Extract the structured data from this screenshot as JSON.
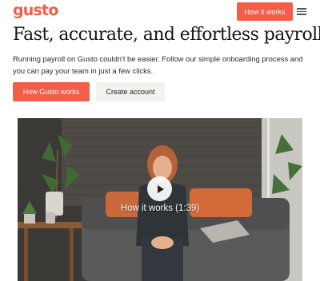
{
  "header": {
    "logo_text": "gusto",
    "nav_cta_label": "How it works",
    "menu_icon": "hamburger-menu-icon"
  },
  "hero": {
    "headline": "Fast, accurate, and effortless payroll.",
    "subtext": "Running payroll on Gusto couldn't be easier. Follow our simple onboarding process and you can pay your team in just a few clicks.",
    "primary_button_label": "How Gusto works",
    "secondary_button_label": "Create account"
  },
  "video": {
    "caption": "How it works (1:39)",
    "play_icon": "play-icon"
  },
  "colors": {
    "brand": "#f45d48",
    "secondary_button_bg": "#f3f2ef",
    "text": "#1c1c1c"
  }
}
